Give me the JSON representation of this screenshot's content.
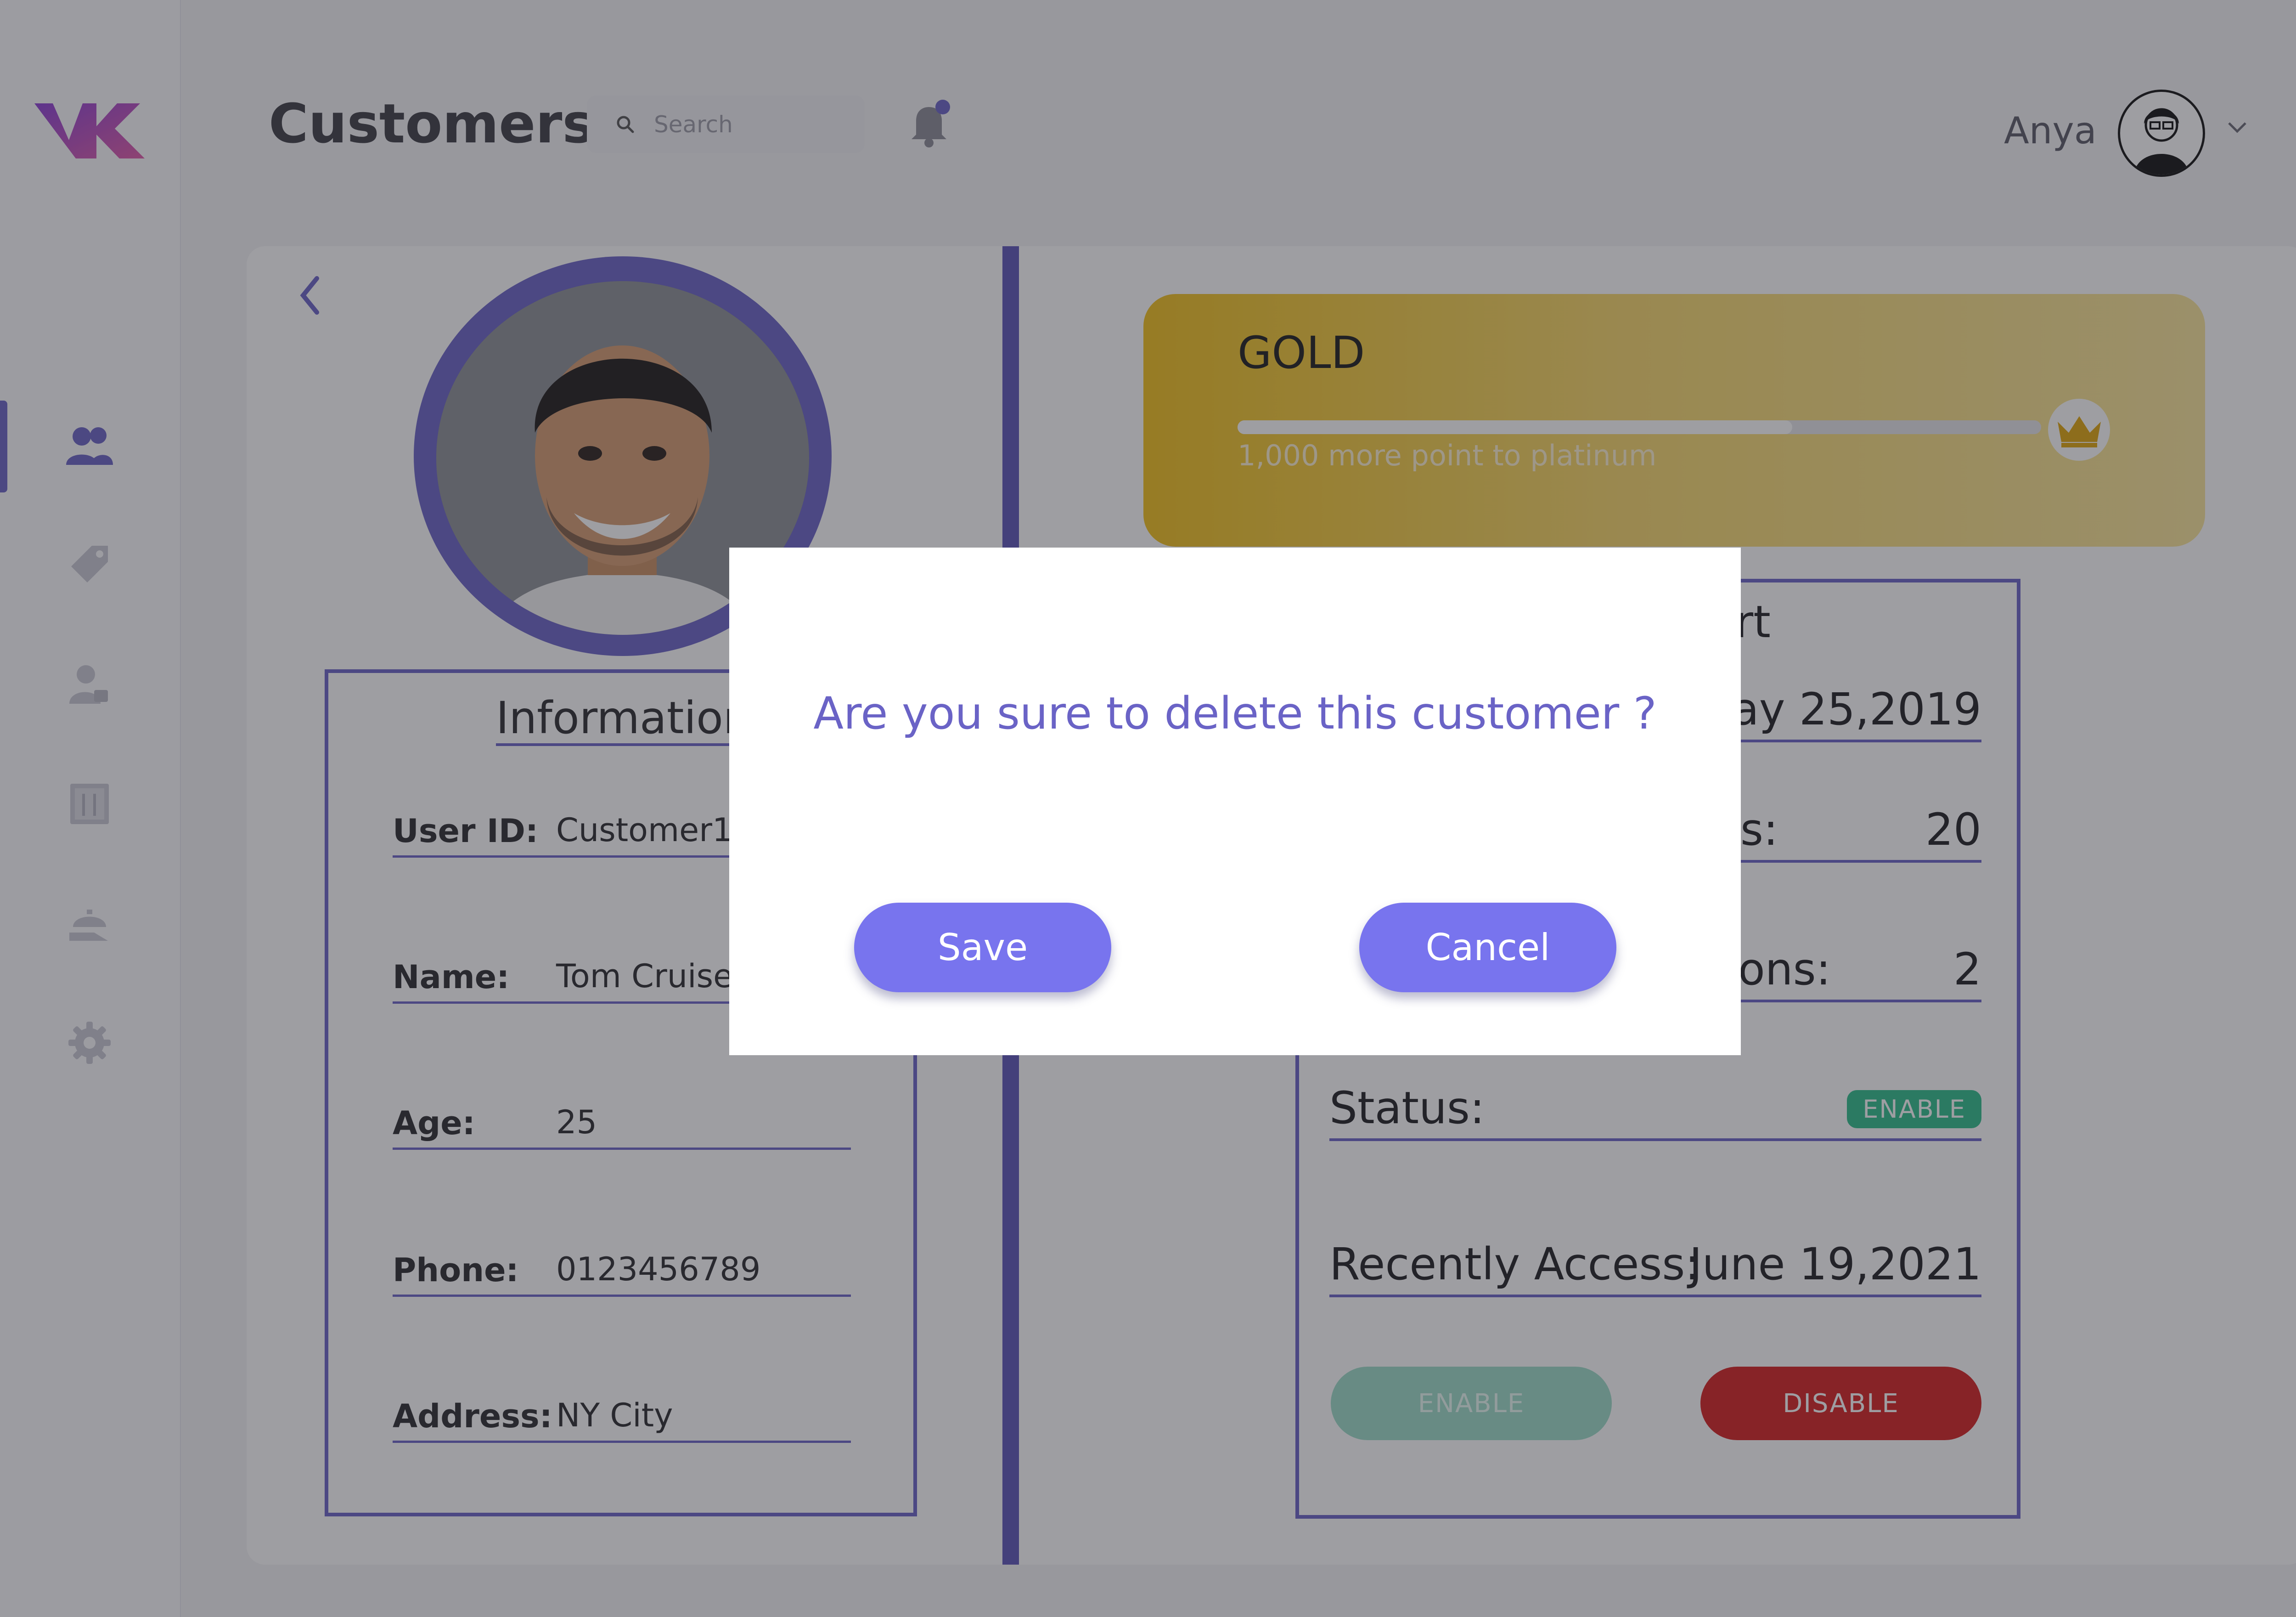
{
  "header": {
    "title": "Customers",
    "search_placeholder": "Search",
    "user_name": "Anya"
  },
  "sidebar": {
    "items": [
      {
        "icon": "users-icon",
        "active": true
      },
      {
        "icon": "tag-icon",
        "active": false
      },
      {
        "icon": "user-lock-icon",
        "active": false
      },
      {
        "icon": "menu-book-icon",
        "active": false
      },
      {
        "icon": "serving-cloche-icon",
        "active": false
      },
      {
        "icon": "gear-icon",
        "active": false
      }
    ]
  },
  "information": {
    "title": "Information",
    "fields": [
      {
        "label": "User ID:",
        "value": "Customer1"
      },
      {
        "label": "Name:",
        "value": "Tom Cruise"
      },
      {
        "label": "Age:",
        "value": "25"
      },
      {
        "label": "Phone:",
        "value": "0123456789"
      },
      {
        "label": "Address:",
        "value": "NY City"
      }
    ]
  },
  "membership": {
    "tier": "GOLD",
    "progress": 0.69,
    "subtitle": "1,000 more point to platinum"
  },
  "report": {
    "title_fragment": "ort",
    "date_fragment": "lay 25,2019",
    "row1_label": "s:",
    "row1_value": "20",
    "row2_label": "ons:",
    "row2_value": "2",
    "status_label": "Status:",
    "status_badge": "ENABLE",
    "recent_label": "Recently Access:",
    "recent_value": "June 19,2021",
    "enable_button": "ENABLE",
    "disable_button": "DISABLE"
  },
  "dialog": {
    "message": "Are you sure to delete this customer ?",
    "save_label": "Save",
    "cancel_label": "Cancel"
  },
  "colors": {
    "accent": "#6a63c6",
    "gold": "#f2c11b",
    "enable": "#2fbd8a",
    "disable": "#d61f1f",
    "dialog_button": "#7874ee"
  }
}
